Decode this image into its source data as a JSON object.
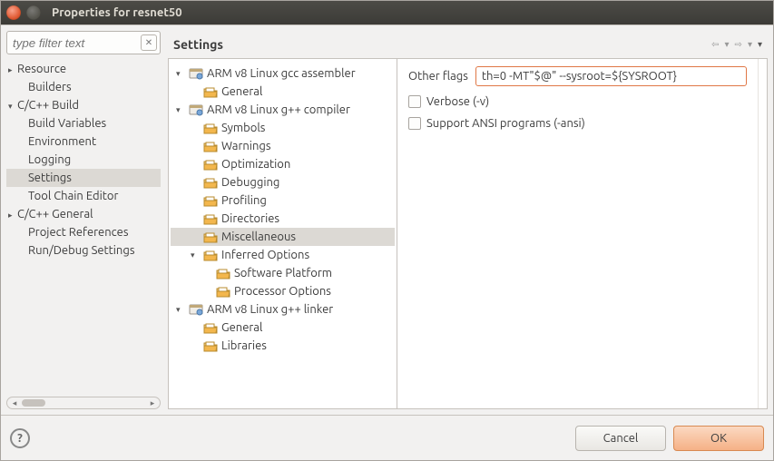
{
  "window_title": "Properties for resnet50",
  "filter": {
    "placeholder": "type filter text"
  },
  "nav": {
    "resource": "Resource",
    "builders": "Builders",
    "cppbuild": "C/C++ Build",
    "cppbuild_items": {
      "build_vars": "Build Variables",
      "environment": "Environment",
      "logging": "Logging",
      "settings": "Settings",
      "tool_chain": "Tool Chain Editor"
    },
    "cppgeneral": "C/C++ General",
    "project_refs": "Project References",
    "run_debug": "Run/Debug Settings"
  },
  "settings_title": "Settings",
  "tree": {
    "asm": "ARM v8 Linux gcc assembler",
    "asm_general": "General",
    "gpp": "ARM v8 Linux g++ compiler",
    "gpp_symbols": "Symbols",
    "gpp_warnings": "Warnings",
    "gpp_optimization": "Optimization",
    "gpp_debugging": "Debugging",
    "gpp_profiling": "Profiling",
    "gpp_directories": "Directories",
    "gpp_misc": "Miscellaneous",
    "gpp_inferred": "Inferred Options",
    "gpp_software_platform": "Software Platform",
    "gpp_processor_options": "Processor Options",
    "link": "ARM v8 Linux g++ linker",
    "link_general": "General",
    "link_libraries": "Libraries"
  },
  "form": {
    "other_flags_label": "Other flags",
    "other_flags_value": "th=0 -MT\"$@\" --sysroot=${SYSROOT}",
    "verbose": "Verbose (-v)",
    "ansi": "Support ANSI programs (-ansi)"
  },
  "buttons": {
    "cancel": "Cancel",
    "ok": "OK"
  }
}
